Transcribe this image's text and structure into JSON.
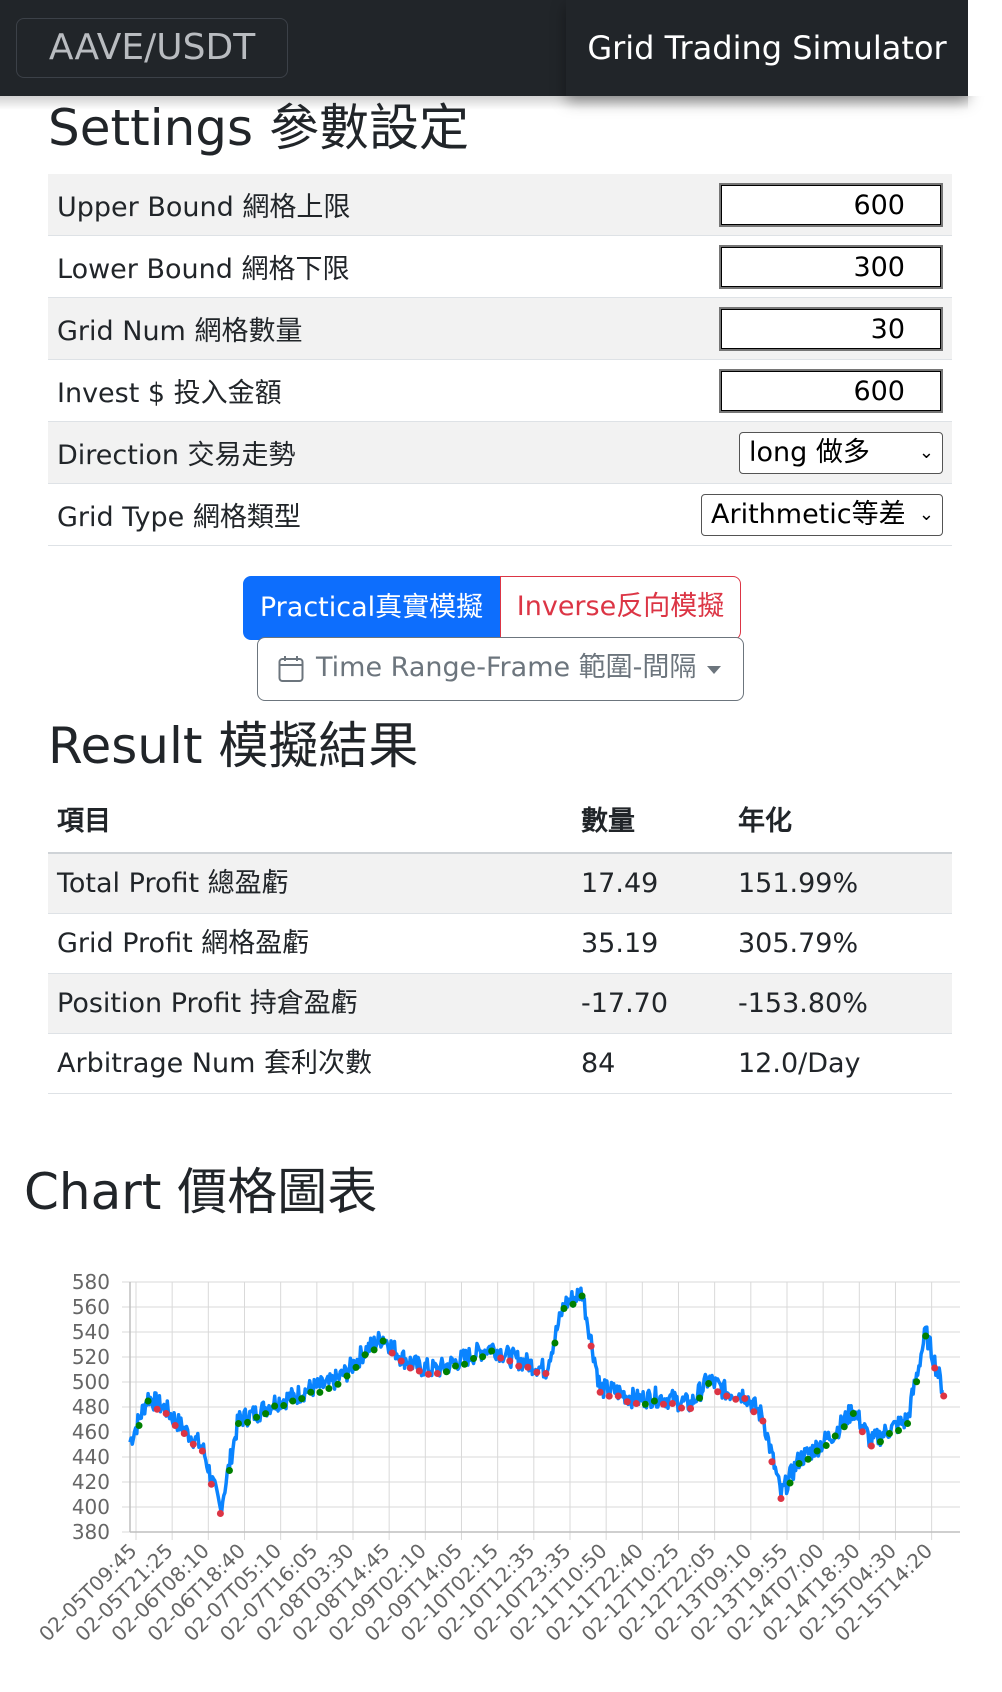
{
  "navbar": {
    "brand": "AAVE/USDT",
    "title": "Grid Trading Simulator"
  },
  "settings": {
    "heading": "Settings 參數設定",
    "rows": [
      {
        "label": "Upper Bound 網格上限",
        "value": "600"
      },
      {
        "label": "Lower Bound 網格下限",
        "value": "300"
      },
      {
        "label": "Grid Num 網格數量",
        "value": "30"
      },
      {
        "label": "Invest $ 投入金額",
        "value": "600"
      },
      {
        "label": "Direction 交易走勢",
        "value": "long 做多"
      },
      {
        "label": "Grid Type 網格類型",
        "value": "Arithmetic等差"
      }
    ]
  },
  "buttons": {
    "practical": "Practical真實模擬",
    "inverse": "Inverse反向模擬",
    "time_range": "Time Range-Frame 範圍-間隔"
  },
  "result": {
    "heading": "Result 模擬結果",
    "columns": [
      "項目",
      "數量",
      "年化"
    ],
    "rows": [
      {
        "item": "Total Profit 總盈虧",
        "amount": "17.49",
        "annual": "151.99%"
      },
      {
        "item": "Grid Profit 網格盈虧",
        "amount": "35.19",
        "annual": "305.79%"
      },
      {
        "item": "Position Profit 持倉盈虧",
        "amount": "-17.70",
        "annual": "-153.80%"
      },
      {
        "item": "Arbitrage Num 套利次數",
        "amount": "84",
        "annual": "12.0/Day"
      }
    ]
  },
  "chart": {
    "heading": "Chart 價格圖表"
  },
  "colors": {
    "primary": "#0d6efd",
    "danger": "#dc3545",
    "navbar": "#212529",
    "line": "#0a84ff",
    "buy": "#008000",
    "sell": "#dc3545"
  },
  "chart_data": {
    "type": "line",
    "ylim": [
      380,
      580
    ],
    "yticks": [
      580,
      560,
      540,
      520,
      500,
      480,
      460,
      440,
      420,
      400,
      380
    ],
    "xticks": [
      "02-05T09:45",
      "02-05T21:25",
      "02-06T08:10",
      "02-06T18:40",
      "02-07T05:10",
      "02-07T16:05",
      "02-08T03:30",
      "02-08T14:45",
      "02-09T02:10",
      "02-09T14:05",
      "02-10T02:15",
      "02-10T12:35",
      "02-10T23:35",
      "02-11T10:50",
      "02-11T22:40",
      "02-12T10:25",
      "02-12T22:05",
      "02-13T09:10",
      "02-13T19:55",
      "02-14T07:00",
      "02-14T18:30",
      "02-15T04:30",
      "02-15T14:20"
    ],
    "grid": true,
    "series": [
      {
        "x": [
          "02-05T09:45",
          "02-05T15:35",
          "02-05T21:25",
          "02-06T02:50",
          "02-06T08:10",
          "02-06T13:25",
          "02-06T18:40",
          "02-06T23:55",
          "02-07T05:10",
          "02-07T10:35",
          "02-07T16:05",
          "02-07T21:50",
          "02-08T03:30",
          "02-08T09:10",
          "02-08T14:45",
          "02-08T20:30",
          "02-09T02:10",
          "02-09T08:05",
          "02-09T14:05",
          "02-09T20:10",
          "02-10T02:15",
          "02-10T07:25",
          "02-10T12:35",
          "02-10T18:05",
          "02-10T23:35",
          "02-11T05:10",
          "02-11T10:50",
          "02-11T16:45",
          "02-11T22:40",
          "02-12T04:30",
          "02-12T10:25",
          "02-12T16:15",
          "02-12T22:05",
          "02-13T03:40",
          "02-13T09:10",
          "02-13T14:30",
          "02-13T19:55",
          "02-14T01:25",
          "02-14T07:00",
          "02-14T12:45",
          "02-14T18:30",
          "02-14T23:30",
          "02-15T04:30",
          "02-15T09:25",
          "02-15T14:20",
          "02-15T19:00"
        ],
        "values": [
          452,
          488,
          478,
          462,
          448,
          398,
          470,
          475,
          484,
          488,
          495,
          498,
          508,
          525,
          536,
          520,
          512,
          510,
          516,
          522,
          528,
          520,
          515,
          510,
          562,
          572,
          495,
          492,
          486,
          488,
          486,
          482,
          502,
          492,
          490,
          472,
          410,
          438,
          448,
          460,
          478,
          452,
          462,
          470,
          540,
          492
        ]
      }
    ]
  }
}
